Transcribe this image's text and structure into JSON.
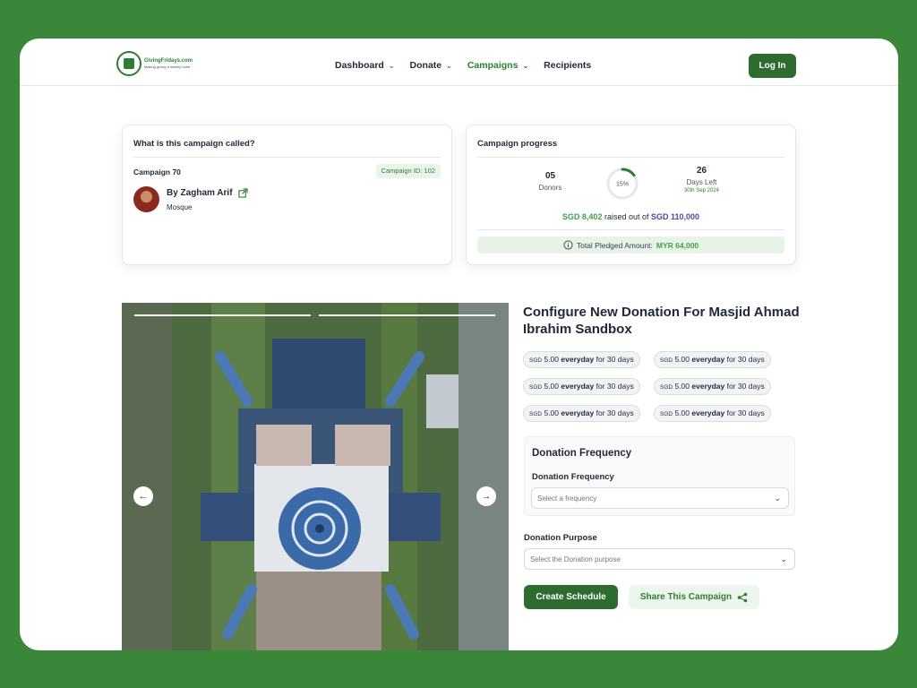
{
  "header": {
    "logo_name": "GivingFridays.com",
    "logo_tagline": "Making giving a weekly habit",
    "nav": [
      {
        "label": "Dashboard",
        "has_dropdown": true,
        "active": false
      },
      {
        "label": "Donate",
        "has_dropdown": true,
        "active": false
      },
      {
        "label": "Campaigns",
        "has_dropdown": true,
        "active": true
      },
      {
        "label": "Recipients",
        "has_dropdown": false,
        "active": false
      }
    ],
    "login_label": "Log In"
  },
  "campaign_card": {
    "title": "What is this campaign called?",
    "campaign_name": "Campaign 70",
    "campaign_id": "Campaign ID: 102",
    "author": "By Zagham Arif",
    "author_type": "Mosque"
  },
  "progress_card": {
    "title": "Campaign progress",
    "donors_value": "05",
    "donors_label": "Donors",
    "percent_label": "15%",
    "percent": 15,
    "days_value": "26",
    "days_label": "Days Left",
    "end_date": "30th Sep 2024",
    "raised_amount": "SGD 8,402",
    "raised_text": "raised out of",
    "goal_amount": "SGD 110,000",
    "pledged_label": "Total Pledged Amount:",
    "pledged_amount": "MYR 64,000"
  },
  "form": {
    "title": "Configure New Donation For Masjid Ahmad Ibrahim Sandbox",
    "chips": [
      {
        "currency": "SGD",
        "amount": "5.00",
        "freq": "everyday",
        "duration": "for 30 days"
      },
      {
        "currency": "SGD",
        "amount": "5.00",
        "freq": "everyday",
        "duration": "for 30 days"
      },
      {
        "currency": "SGD",
        "amount": "5.00",
        "freq": "everyday",
        "duration": "for 30 days"
      },
      {
        "currency": "SGD",
        "amount": "5.00",
        "freq": "everyday",
        "duration": "for 30 days"
      },
      {
        "currency": "SGD",
        "amount": "5.00",
        "freq": "everyday",
        "duration": "for 30 days"
      },
      {
        "currency": "SGD",
        "amount": "5.00",
        "freq": "everyday",
        "duration": "for 30 days"
      }
    ],
    "frequency_section_title": "Donation Frequency",
    "frequency_label": "Donation Frequency",
    "frequency_placeholder": "Select a frequency",
    "purpose_label": "Donation Purpose",
    "purpose_placeholder": "Select the Donation purpose",
    "create_label": "Create Schedule",
    "share_label": "Share This Campaign"
  },
  "colors": {
    "brand_green": "#2e6b2e",
    "accent_green": "#43a047",
    "goal_purple": "#5046a8",
    "page_bg": "#3a873a"
  }
}
